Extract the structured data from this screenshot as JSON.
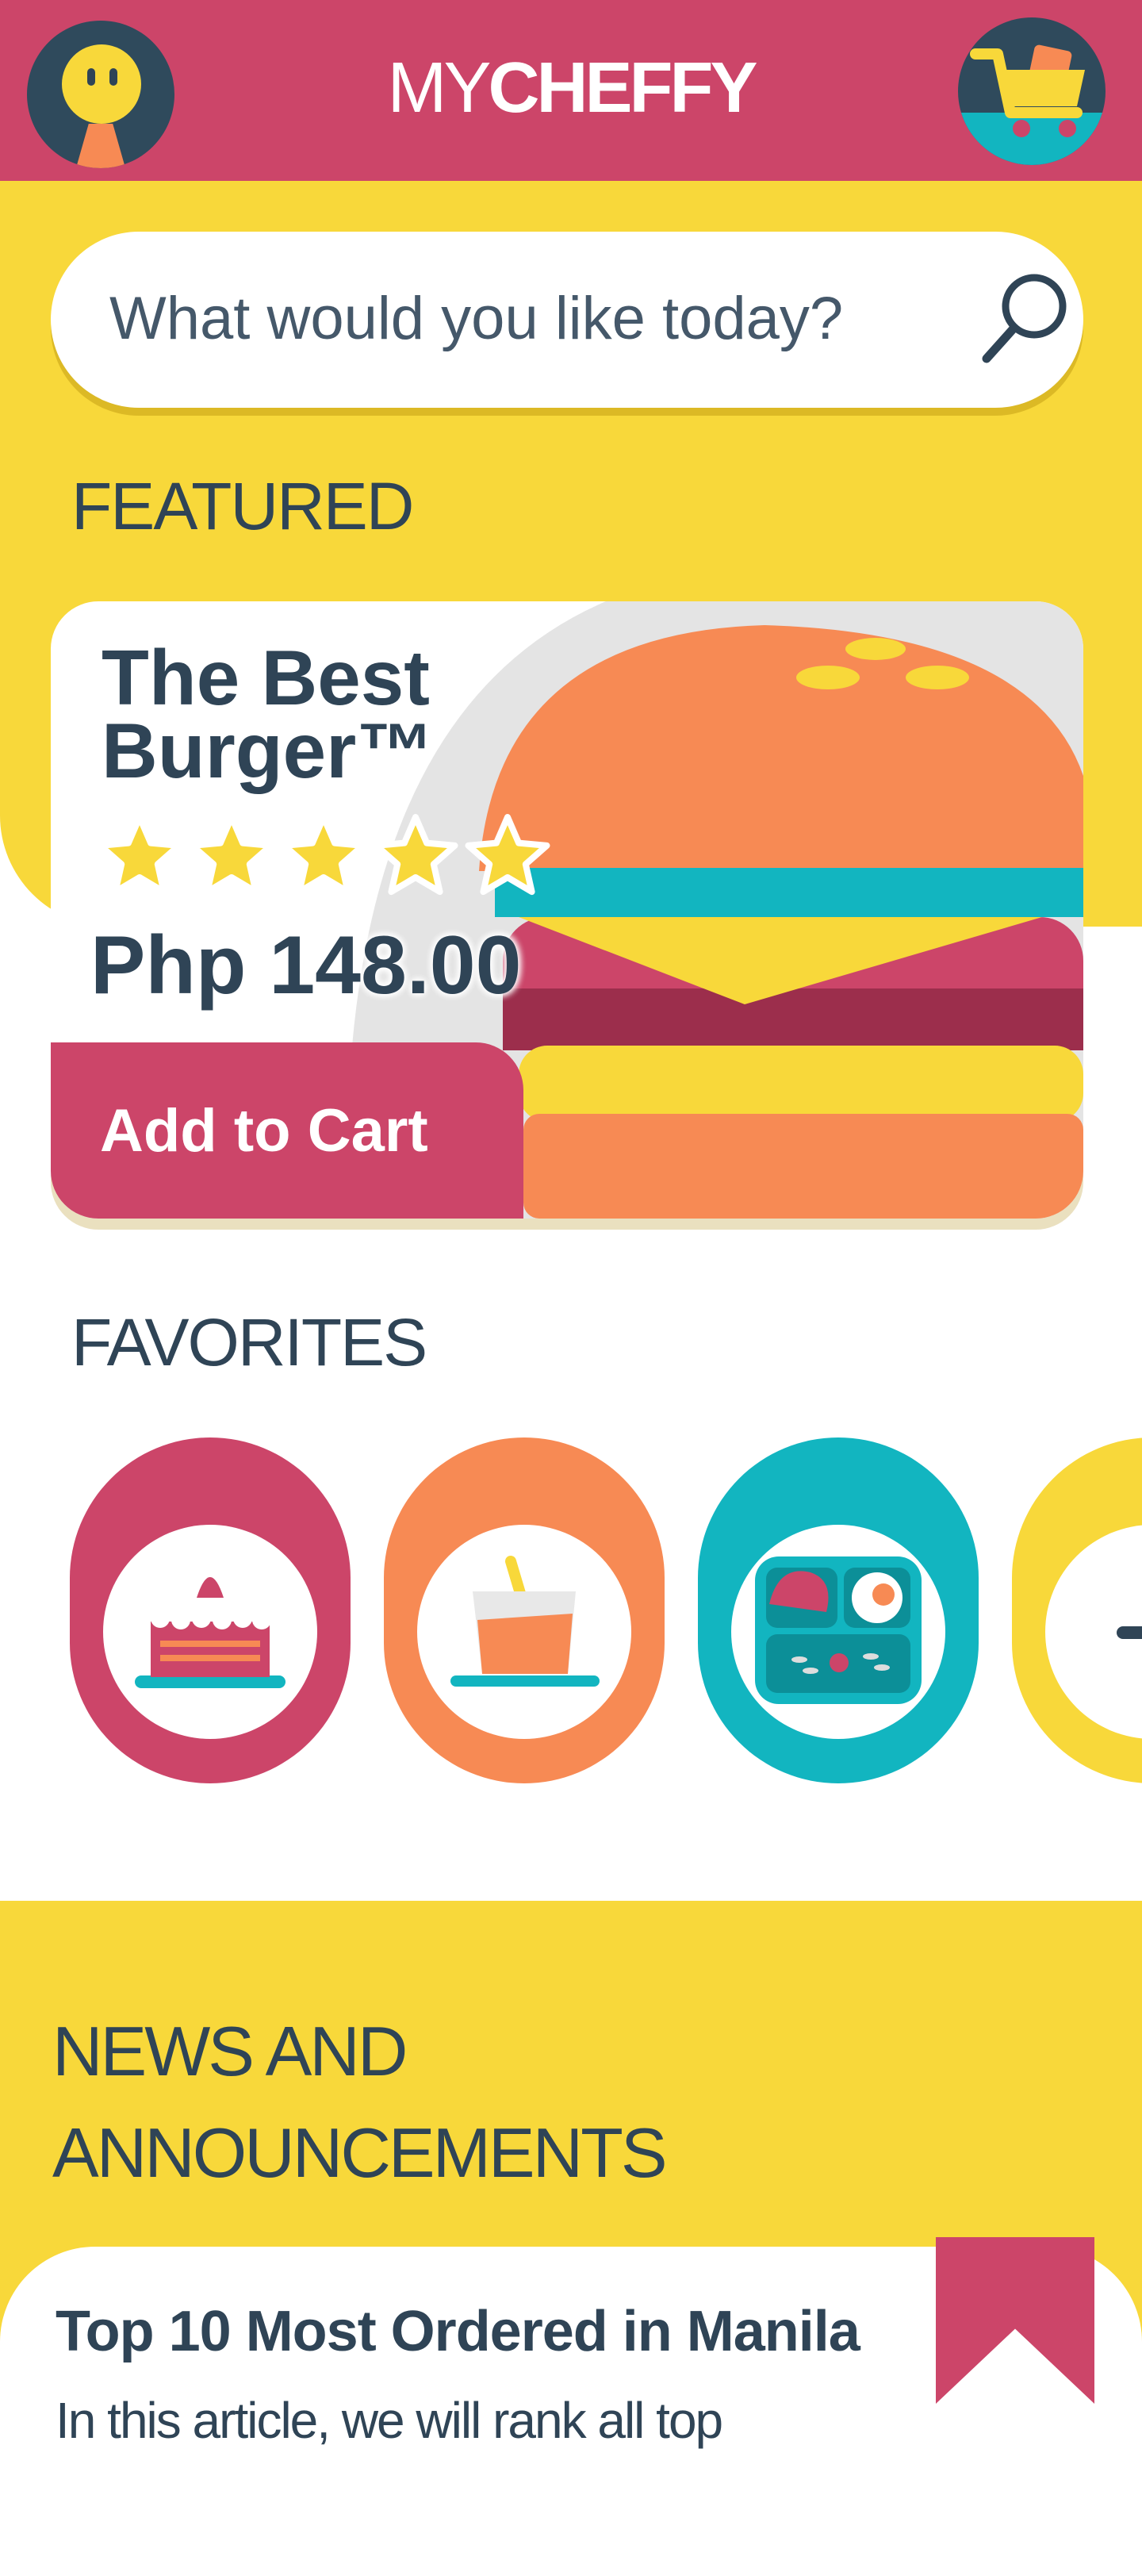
{
  "app": {
    "brand_light": "MY",
    "brand_bold": "CHEFFY"
  },
  "search": {
    "placeholder": "What would you like today?"
  },
  "featured": {
    "section_title": "FEATURED",
    "item_title_line1": "The Best",
    "item_title_line2": "Burger™",
    "rating": 5,
    "price": "Php 148.00",
    "add_to_cart_label": "Add to Cart"
  },
  "favorites": {
    "section_title": "FAVORITES",
    "items": [
      {
        "icon": "cake-icon",
        "color": "#cc4569"
      },
      {
        "icon": "drink-icon",
        "color": "#f78a54"
      },
      {
        "icon": "bento-icon",
        "color": "#12b5c0"
      },
      {
        "icon": "menu-icon",
        "color": "#f8d83a"
      }
    ]
  },
  "news": {
    "section_title_line1": "NEWS AND",
    "section_title_line2": "ANNOUNCEMENTS",
    "article_title": "Top 10 Most Ordered in Manila",
    "article_excerpt": "In this article, we will rank all top"
  },
  "colors": {
    "primary": "#cc4569",
    "yellow": "#f8d83a",
    "orange": "#f78a54",
    "teal": "#12b5c0",
    "navy": "#2f4456"
  }
}
